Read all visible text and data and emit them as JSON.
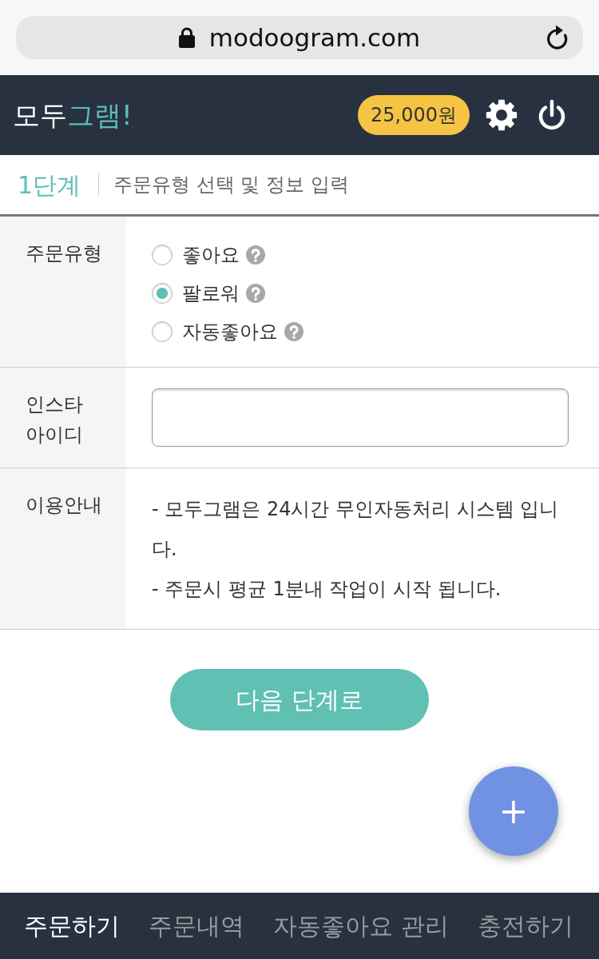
{
  "browser": {
    "url": "modoogram.com"
  },
  "header": {
    "logo": {
      "text": "모두",
      "accent_text": "그램!"
    },
    "balance": "25,000원"
  },
  "step": {
    "number": "1단계",
    "title": "주문유형 선택 및 정보 입력"
  },
  "rows": [
    {
      "kind": "radios",
      "label": "주문유형",
      "options": [
        {
          "label": "좋아요",
          "selected": false
        },
        {
          "label": "팔로워",
          "selected": true
        },
        {
          "label": "자동좋아요",
          "selected": false
        }
      ]
    },
    {
      "kind": "input",
      "label": "인스타 아이디"
    },
    {
      "kind": "notes",
      "label": "이용안내",
      "lines": [
        "- 모두그램은 24시간 무인자동처리 시스템 입니다.",
        "- 주문시 평균 1분내 작업이 시작 됩니다."
      ]
    }
  ],
  "next_button": "다음 단계로",
  "fab": "+",
  "bottom_nav": [
    {
      "label": "주문하기",
      "selected": true
    },
    {
      "label": "주문내역",
      "selected": false
    },
    {
      "label": "자동좋아요 관리",
      "selected": false
    },
    {
      "label": "충전하기",
      "selected": false
    }
  ]
}
